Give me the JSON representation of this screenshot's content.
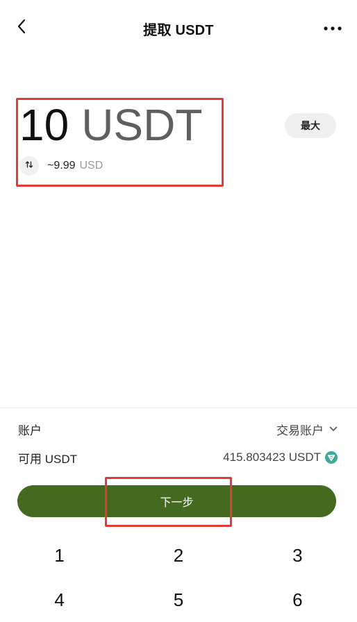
{
  "header": {
    "title": "提取 USDT",
    "back_icon": "chevron-left-icon",
    "more_icon": "ellipsis-icon"
  },
  "amount": {
    "value": "10",
    "currency": "USDT",
    "converted_value": "~9.99",
    "converted_currency": "USD",
    "swap_icon": "swap-vertical-icon",
    "max_label": "最大"
  },
  "account": {
    "label": "账户",
    "value": "交易账户",
    "chevron_icon": "chevron-down-icon"
  },
  "available": {
    "label": "可用 USDT",
    "value": "415.803423 USDT",
    "coin_icon": "tron-icon"
  },
  "next_button": {
    "label": "下一步"
  },
  "keypad": {
    "rows": [
      [
        "1",
        "2",
        "3"
      ],
      [
        "4",
        "5",
        "6"
      ]
    ]
  },
  "colors": {
    "primary_button": "#436a1f",
    "highlight": "#e53935",
    "coin_icon": "#3fa89a"
  }
}
